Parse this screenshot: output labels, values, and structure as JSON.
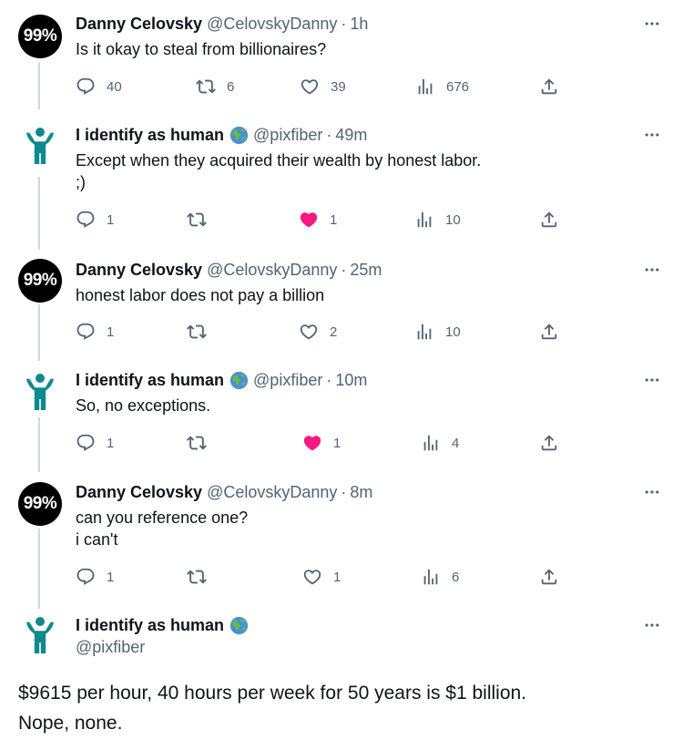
{
  "tweets": [
    {
      "name": "Danny Celovsky",
      "handle": "@CelovskyDanny",
      "time": "1h",
      "avatar_text": "99%",
      "text": "Is it okay to steal from billionaires?",
      "replies": "40",
      "retweets": "6",
      "likes": "39",
      "views": "676",
      "liked": false
    },
    {
      "name": "I identify as human",
      "handle": "@pixfiber",
      "time": "49m",
      "avatar_icon": "human-figure-icon",
      "text": "Except when they acquired their wealth by honest labor.\n;)",
      "replies": "1",
      "retweets": "",
      "likes": "1",
      "views": "10",
      "liked": true
    },
    {
      "name": "Danny Celovsky",
      "handle": "@CelovskyDanny",
      "time": "25m",
      "avatar_text": "99%",
      "text": "honest labor does not pay a billion",
      "replies": "1",
      "retweets": "",
      "likes": "2",
      "views": "10",
      "liked": false
    },
    {
      "name": "I identify as human",
      "handle": "@pixfiber",
      "time": "10m",
      "avatar_icon": "human-figure-icon",
      "text": "So, no exceptions.",
      "replies": "1",
      "retweets": "",
      "likes": "1",
      "views": "4",
      "liked": true
    },
    {
      "name": "Danny Celovsky",
      "handle": "@CelovskyDanny",
      "time": "8m",
      "avatar_text": "99%",
      "text": "can you reference one?\ni can't",
      "replies": "1",
      "retweets": "",
      "likes": "1",
      "views": "6",
      "liked": false
    }
  ],
  "main_tweet": {
    "name": "I identify as human",
    "handle": "@pixfiber",
    "avatar_icon": "human-figure-icon",
    "text": "$9615 per hour, 40 hours per week for 50 years is $1 billion.\nNope, none."
  },
  "colors": {
    "text": "#0f1419",
    "secondary": "#536471",
    "like_pink": "#f91880",
    "thread_line": "#cfd9de",
    "avatar_teal": "#0e8a8c"
  }
}
